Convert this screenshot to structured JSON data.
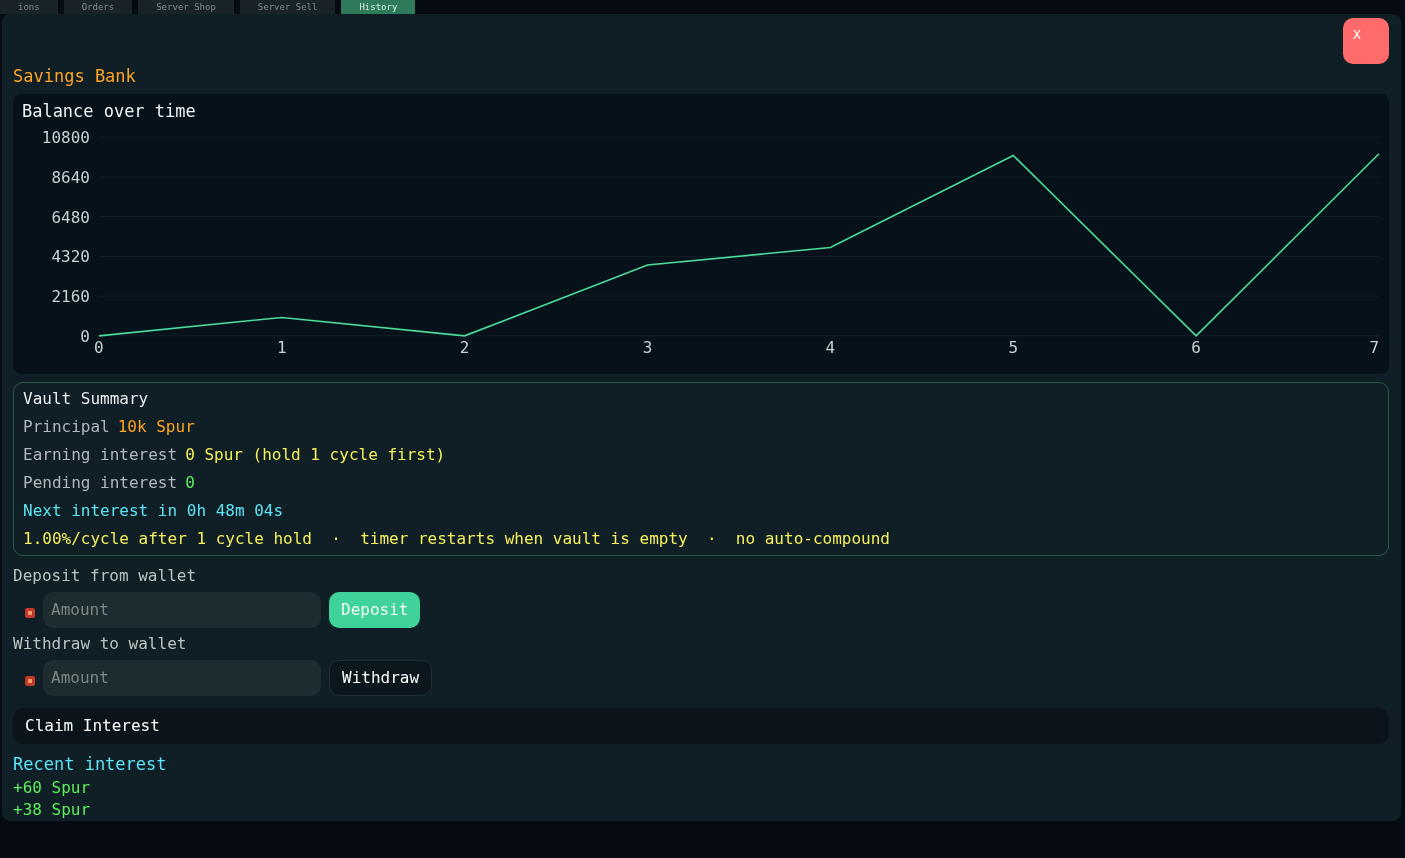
{
  "tabs": [
    {
      "label": "ions",
      "selected": false
    },
    {
      "label": "Orders",
      "selected": false
    },
    {
      "label": "Server Shop",
      "selected": false
    },
    {
      "label": "Server Sell",
      "selected": false
    },
    {
      "label": "History",
      "selected": true
    }
  ],
  "close_button": {
    "label": "X"
  },
  "title": "Savings Bank",
  "chart": {
    "chart_data": {
      "type": "line",
      "title": "Balance over time",
      "x": [
        0,
        1,
        2,
        3,
        4,
        5,
        6,
        7
      ],
      "grid": true,
      "series": [
        {
          "color": "#4ade9a",
          "values": [
            0,
            1000,
            0,
            3850,
            4800,
            9800,
            0,
            9900
          ]
        }
      ],
      "xlim": [
        0,
        7
      ],
      "ylim": [
        0,
        10800
      ],
      "xticks": [
        0,
        1,
        2,
        3,
        4,
        5,
        6,
        7
      ],
      "yticks": [
        0,
        2160,
        4320,
        6480,
        8640,
        10800
      ]
    }
  },
  "summary": {
    "title": "Vault Summary",
    "lines": [
      {
        "label": "Principal",
        "value": "10k Spur",
        "color": "#ffa51f"
      },
      {
        "label": "Earning interest",
        "value": "0 Spur (hold 1 cycle first)",
        "color": "#f5f05a"
      },
      {
        "label": "Pending interest",
        "value": "0",
        "color": "#5cf05c"
      },
      {
        "text": "Next interest in 0h 48m 04s",
        "color": "#5ce6f5"
      },
      {
        "text": "1.00%/cycle after 1 cycle hold  ·  timer restarts when vault is empty  ·  no auto-compound",
        "color": "#f5f05a"
      }
    ]
  },
  "deposit": {
    "label": "Deposit from wallet",
    "placeholder": "Amount",
    "button": "Deposit",
    "kind": "primary"
  },
  "withdraw": {
    "label": "Withdraw to wallet",
    "placeholder": "Amount",
    "button": "Withdraw",
    "kind": "outline"
  },
  "claim_button": "Claim Interest",
  "recent": {
    "title": "Recent interest",
    "entries": [
      "+60 Spur",
      "+38 Spur"
    ]
  }
}
